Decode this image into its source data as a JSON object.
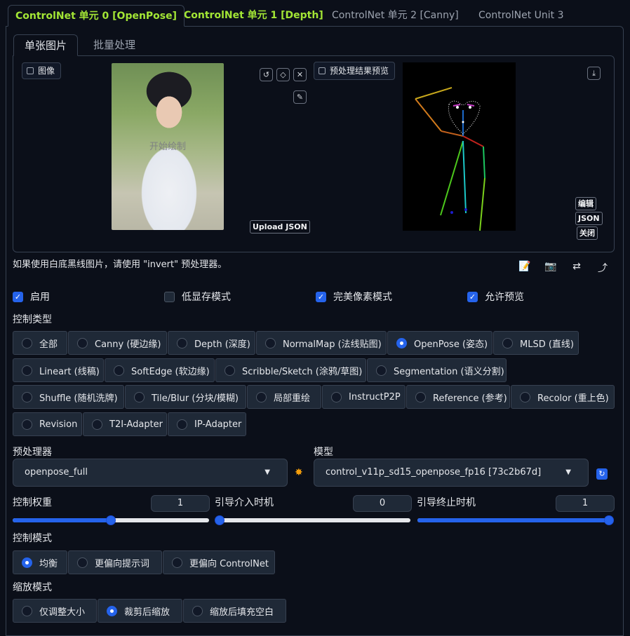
{
  "tabs": [
    {
      "label": "ControlNet 单元 0 [OpenPose]"
    },
    {
      "label": "ControlNet 单元 1 [Depth]"
    },
    {
      "label": "ControlNet 单元 2 [Canny]"
    },
    {
      "label": "ControlNet Unit 3"
    }
  ],
  "subtabs": [
    {
      "label": "单张图片"
    },
    {
      "label": "批量处理"
    }
  ],
  "image_panel": {
    "image_label": "图像",
    "canvas_hint": "开始绘制",
    "upload_json": "Upload JSON",
    "preview_label": "预处理结果预览",
    "edit_btn": "编辑",
    "json_btn": "JSON",
    "close_btn": "关闭"
  },
  "hint_text": "如果使用白底黑线图片，请使用 \"invert\" 预处理器。",
  "options": {
    "enable": {
      "label": "启用",
      "checked": true
    },
    "low_vram": {
      "label": "低显存模式",
      "checked": false
    },
    "pixel_perfect": {
      "label": "完美像素模式",
      "checked": true
    },
    "allow_preview": {
      "label": "允许预览",
      "checked": true
    }
  },
  "control_type": {
    "label": "控制类型",
    "selected": "OpenPose (姿态)",
    "items": [
      "全部",
      "Canny (硬边缘)",
      "Depth (深度)",
      "NormalMap (法线贴图)",
      "OpenPose (姿态)",
      "MLSD (直线)",
      "Lineart (线稿)",
      "SoftEdge (软边缘)",
      "Scribble/Sketch (涂鸦/草图)",
      "Segmentation (语义分割)",
      "Shuffle (随机洗牌)",
      "Tile/Blur (分块/模糊)",
      "局部重绘",
      "InstructP2P",
      "Reference (参考)",
      "Recolor (重上色)",
      "Revision",
      "T2I-Adapter",
      "IP-Adapter"
    ]
  },
  "preprocessor": {
    "label": "预处理器",
    "value": "openpose_full"
  },
  "model": {
    "label": "模型",
    "value": "control_v11p_sd15_openpose_fp16 [73c2b67d]"
  },
  "sliders": {
    "weight": {
      "label": "控制权重",
      "value": "1",
      "fraction": 0.5
    },
    "start": {
      "label": "引导介入时机",
      "value": "0",
      "fraction": 0.0
    },
    "end": {
      "label": "引导终止时机",
      "value": "1",
      "fraction": 1.0
    }
  },
  "control_mode": {
    "label": "控制模式",
    "selected": "均衡",
    "items": [
      "均衡",
      "更偏向提示词",
      "更偏向 ControlNet"
    ]
  },
  "resize_mode": {
    "label": "缩放模式",
    "selected": "裁剪后缩放",
    "items": [
      "仅调整大小",
      "裁剪后缩放",
      "缩放后填充空白"
    ]
  },
  "colors": {
    "accent": "#2563eb",
    "active_tab": "#a3e635",
    "background": "#0b0f19",
    "border": "#374151"
  }
}
